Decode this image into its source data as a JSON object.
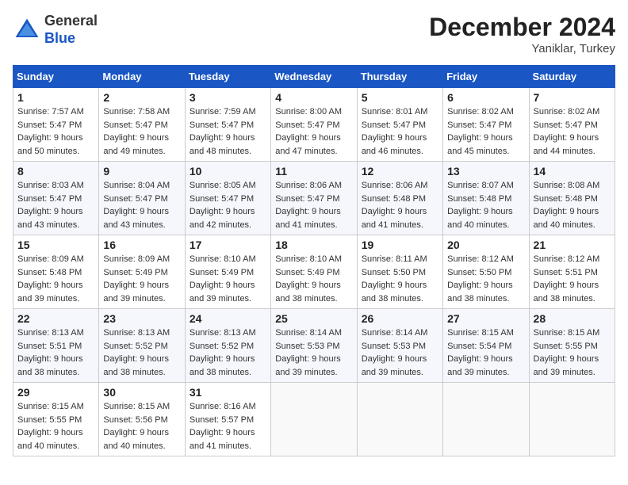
{
  "header": {
    "logo_general": "General",
    "logo_blue": "Blue",
    "title": "December 2024",
    "location": "Yaniklar, Turkey"
  },
  "weekdays": [
    "Sunday",
    "Monday",
    "Tuesday",
    "Wednesday",
    "Thursday",
    "Friday",
    "Saturday"
  ],
  "weeks": [
    [
      {
        "day": 1,
        "sunrise": "7:57 AM",
        "sunset": "5:47 PM",
        "daylight": "9 hours and 50 minutes."
      },
      {
        "day": 2,
        "sunrise": "7:58 AM",
        "sunset": "5:47 PM",
        "daylight": "9 hours and 49 minutes."
      },
      {
        "day": 3,
        "sunrise": "7:59 AM",
        "sunset": "5:47 PM",
        "daylight": "9 hours and 48 minutes."
      },
      {
        "day": 4,
        "sunrise": "8:00 AM",
        "sunset": "5:47 PM",
        "daylight": "9 hours and 47 minutes."
      },
      {
        "day": 5,
        "sunrise": "8:01 AM",
        "sunset": "5:47 PM",
        "daylight": "9 hours and 46 minutes."
      },
      {
        "day": 6,
        "sunrise": "8:02 AM",
        "sunset": "5:47 PM",
        "daylight": "9 hours and 45 minutes."
      },
      {
        "day": 7,
        "sunrise": "8:02 AM",
        "sunset": "5:47 PM",
        "daylight": "9 hours and 44 minutes."
      }
    ],
    [
      {
        "day": 8,
        "sunrise": "8:03 AM",
        "sunset": "5:47 PM",
        "daylight": "9 hours and 43 minutes."
      },
      {
        "day": 9,
        "sunrise": "8:04 AM",
        "sunset": "5:47 PM",
        "daylight": "9 hours and 43 minutes."
      },
      {
        "day": 10,
        "sunrise": "8:05 AM",
        "sunset": "5:47 PM",
        "daylight": "9 hours and 42 minutes."
      },
      {
        "day": 11,
        "sunrise": "8:06 AM",
        "sunset": "5:47 PM",
        "daylight": "9 hours and 41 minutes."
      },
      {
        "day": 12,
        "sunrise": "8:06 AM",
        "sunset": "5:48 PM",
        "daylight": "9 hours and 41 minutes."
      },
      {
        "day": 13,
        "sunrise": "8:07 AM",
        "sunset": "5:48 PM",
        "daylight": "9 hours and 40 minutes."
      },
      {
        "day": 14,
        "sunrise": "8:08 AM",
        "sunset": "5:48 PM",
        "daylight": "9 hours and 40 minutes."
      }
    ],
    [
      {
        "day": 15,
        "sunrise": "8:09 AM",
        "sunset": "5:48 PM",
        "daylight": "9 hours and 39 minutes."
      },
      {
        "day": 16,
        "sunrise": "8:09 AM",
        "sunset": "5:49 PM",
        "daylight": "9 hours and 39 minutes."
      },
      {
        "day": 17,
        "sunrise": "8:10 AM",
        "sunset": "5:49 PM",
        "daylight": "9 hours and 39 minutes."
      },
      {
        "day": 18,
        "sunrise": "8:10 AM",
        "sunset": "5:49 PM",
        "daylight": "9 hours and 38 minutes."
      },
      {
        "day": 19,
        "sunrise": "8:11 AM",
        "sunset": "5:50 PM",
        "daylight": "9 hours and 38 minutes."
      },
      {
        "day": 20,
        "sunrise": "8:12 AM",
        "sunset": "5:50 PM",
        "daylight": "9 hours and 38 minutes."
      },
      {
        "day": 21,
        "sunrise": "8:12 AM",
        "sunset": "5:51 PM",
        "daylight": "9 hours and 38 minutes."
      }
    ],
    [
      {
        "day": 22,
        "sunrise": "8:13 AM",
        "sunset": "5:51 PM",
        "daylight": "9 hours and 38 minutes."
      },
      {
        "day": 23,
        "sunrise": "8:13 AM",
        "sunset": "5:52 PM",
        "daylight": "9 hours and 38 minutes."
      },
      {
        "day": 24,
        "sunrise": "8:13 AM",
        "sunset": "5:52 PM",
        "daylight": "9 hours and 38 minutes."
      },
      {
        "day": 25,
        "sunrise": "8:14 AM",
        "sunset": "5:53 PM",
        "daylight": "9 hours and 39 minutes."
      },
      {
        "day": 26,
        "sunrise": "8:14 AM",
        "sunset": "5:53 PM",
        "daylight": "9 hours and 39 minutes."
      },
      {
        "day": 27,
        "sunrise": "8:15 AM",
        "sunset": "5:54 PM",
        "daylight": "9 hours and 39 minutes."
      },
      {
        "day": 28,
        "sunrise": "8:15 AM",
        "sunset": "5:55 PM",
        "daylight": "9 hours and 39 minutes."
      }
    ],
    [
      {
        "day": 29,
        "sunrise": "8:15 AM",
        "sunset": "5:55 PM",
        "daylight": "9 hours and 40 minutes."
      },
      {
        "day": 30,
        "sunrise": "8:15 AM",
        "sunset": "5:56 PM",
        "daylight": "9 hours and 40 minutes."
      },
      {
        "day": 31,
        "sunrise": "8:16 AM",
        "sunset": "5:57 PM",
        "daylight": "9 hours and 41 minutes."
      },
      null,
      null,
      null,
      null
    ]
  ]
}
